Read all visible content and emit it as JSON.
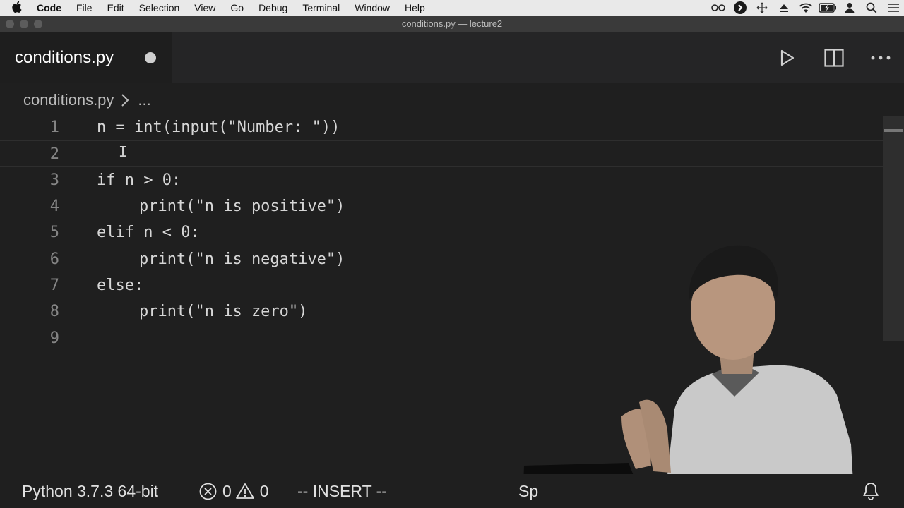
{
  "menubar": {
    "apple_icon": "apple-icon",
    "items": [
      "Code",
      "File",
      "Edit",
      "Selection",
      "View",
      "Go",
      "Debug",
      "Terminal",
      "Window",
      "Help"
    ],
    "status_icons": [
      "glasses-icon",
      "arrow-circle-icon",
      "move-icon",
      "eject-icon",
      "wifi-icon",
      "battery-icon",
      "user-icon",
      "search-icon",
      "list-icon"
    ]
  },
  "window": {
    "title": "conditions.py — lecture2"
  },
  "tab": {
    "label": "conditions.py",
    "dirty": true
  },
  "actions": [
    "run-icon",
    "split-editor-icon",
    "more-icon"
  ],
  "breadcrumb": {
    "file": "conditions.py",
    "more": "..."
  },
  "editor": {
    "lines": [
      {
        "number": "1",
        "code": "n = int(input(\"Number: \"))",
        "indent": false
      },
      {
        "number": "2",
        "code": "",
        "indent": false
      },
      {
        "number": "3",
        "code": "if n > 0:",
        "indent": false
      },
      {
        "number": "4",
        "code": "print(\"n is positive\")",
        "indent": true
      },
      {
        "number": "5",
        "code": "elif n < 0:",
        "indent": false
      },
      {
        "number": "6",
        "code": "print(\"n is negative\")",
        "indent": true
      },
      {
        "number": "7",
        "code": "else:",
        "indent": false
      },
      {
        "number": "8",
        "code": "print(\"n is zero\")",
        "indent": true
      },
      {
        "number": "9",
        "code": "",
        "indent": false
      }
    ],
    "cursor_line": "2"
  },
  "statusbar": {
    "interpreter": "Python 3.7.3 64-bit",
    "errors": "0",
    "warnings": "0",
    "mode": "-- INSERT --",
    "partial": "Sp",
    "bell_icon": "bell-icon"
  },
  "colors": {
    "editor_bg": "#1e1e1e",
    "tab_bar_bg": "#252526",
    "line_number": "#858585",
    "text": "#d6d6d6"
  }
}
